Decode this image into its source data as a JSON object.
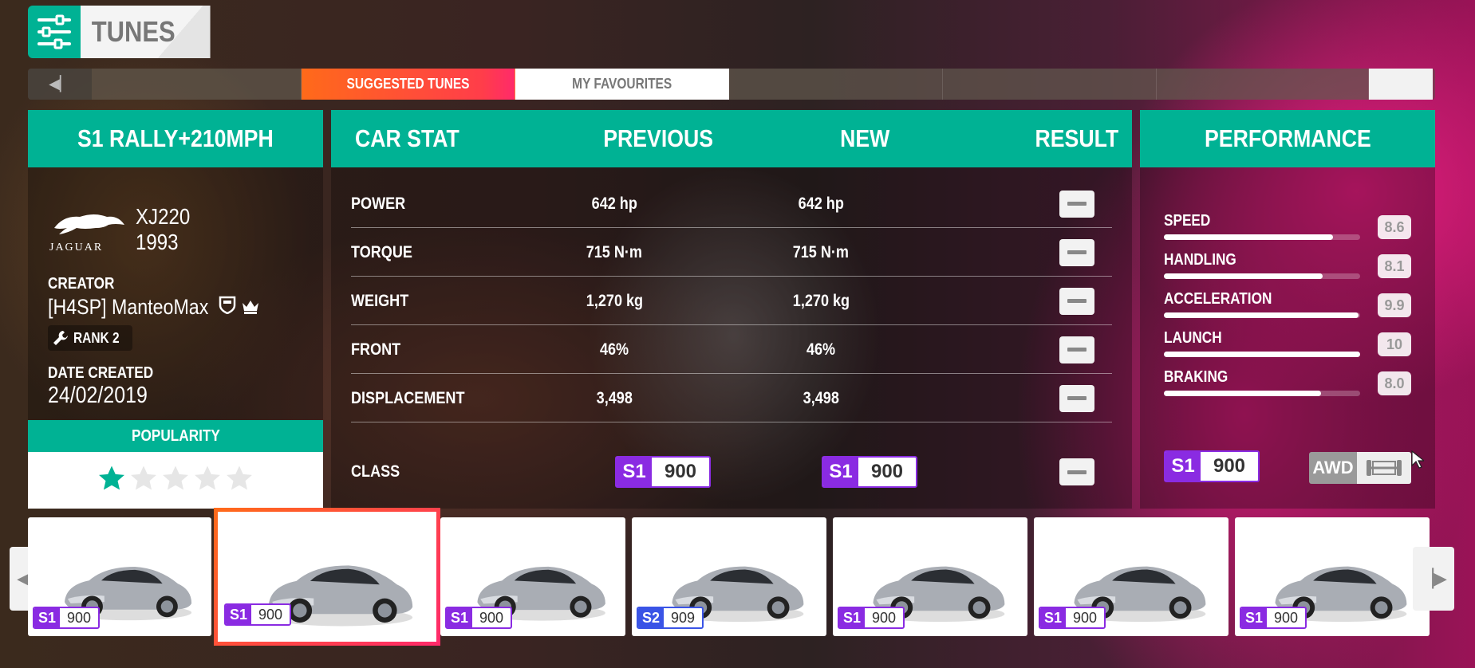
{
  "header": {
    "title": "TUNES",
    "icon": "tune-sliders-icon"
  },
  "tabs": {
    "left_nav_icon": "prev-tab-icon",
    "right_nav_icon": "next-tab-icon",
    "items": [
      "SUGGESTED TUNES",
      "MY FAVOURITES"
    ],
    "active": "SUGGESTED TUNES"
  },
  "tune": {
    "name": "S1 RALLY+210MPH",
    "brand": "JAGUAR",
    "model": "XJ220",
    "year": "1993",
    "creator_label": "CREATOR",
    "creator": "[H4SP] ManteoMax",
    "rank": "RANK 2",
    "date_label": "DATE CREATED",
    "date": "24/02/2019",
    "popularity_label": "POPULARITY",
    "popularity_stars": 1,
    "popularity_max": 5
  },
  "stats": {
    "headers": {
      "stat": "CAR STAT",
      "prev": "PREVIOUS",
      "new": "NEW",
      "result": "RESULT"
    },
    "rows": [
      {
        "label": "POWER",
        "prev": "642 hp",
        "new": "642 hp"
      },
      {
        "label": "TORQUE",
        "prev": "715 N·m",
        "new": "715 N·m"
      },
      {
        "label": "WEIGHT",
        "prev": "1,270 kg",
        "new": "1,270 kg"
      },
      {
        "label": "FRONT",
        "prev": "46%",
        "new": "46%"
      },
      {
        "label": "DISPLACEMENT",
        "prev": "3,498",
        "new": "3,498"
      }
    ],
    "class_label": "CLASS",
    "prev_class": {
      "cls": "S1",
      "pi": "900"
    },
    "new_class": {
      "cls": "S1",
      "pi": "900"
    }
  },
  "performance": {
    "title": "PERFORMANCE",
    "items": [
      {
        "name": "SPEED",
        "value": "8.6",
        "level": 0.86
      },
      {
        "name": "HANDLING",
        "value": "8.1",
        "level": 0.81
      },
      {
        "name": "ACCELERATION",
        "value": "9.9",
        "level": 0.99
      },
      {
        "name": "LAUNCH",
        "value": "10",
        "level": 1.0
      },
      {
        "name": "BRAKING",
        "value": "8.0",
        "level": 0.8
      }
    ],
    "class": {
      "cls": "S1",
      "pi": "900"
    },
    "drivetrain": "AWD"
  },
  "carousel": [
    {
      "cls": "S1",
      "pi": "900"
    },
    {
      "cls": "S1",
      "pi": "900",
      "selected": true
    },
    {
      "cls": "S1",
      "pi": "900"
    },
    {
      "cls": "S2",
      "pi": "909"
    },
    {
      "cls": "S1",
      "pi": "900"
    },
    {
      "cls": "S1",
      "pi": "900"
    },
    {
      "cls": "S1",
      "pi": "900"
    }
  ],
  "colors": {
    "accent": "#00b294",
    "s1": "#8a2be2",
    "s2": "#3a54e6",
    "active_tab": "#ff4a3a"
  }
}
